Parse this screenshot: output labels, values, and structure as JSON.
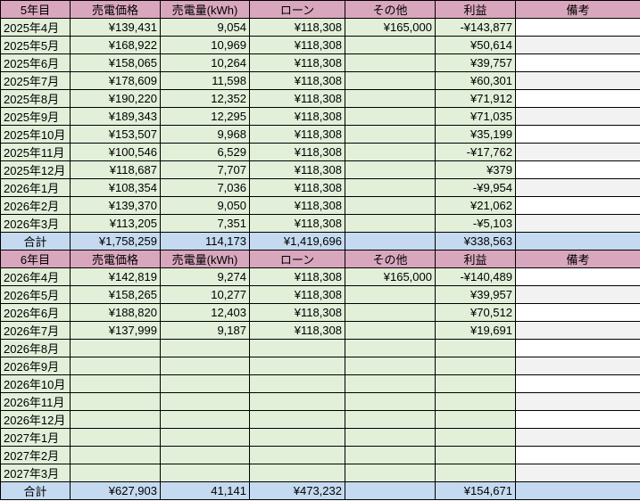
{
  "sections": [
    {
      "header": [
        "5年目",
        "売電価格",
        "売電量(kWh)",
        "ローン",
        "その他",
        "利益",
        "備考"
      ],
      "rows": [
        {
          "month": "2025年4月",
          "price": "¥139,431",
          "kwh": "9,054",
          "loan": "¥118,308",
          "other": "¥165,000",
          "profit": "-¥143,877",
          "note": ""
        },
        {
          "month": "2025年5月",
          "price": "¥168,922",
          "kwh": "10,969",
          "loan": "¥118,308",
          "other": "",
          "profit": "¥50,614",
          "note": ""
        },
        {
          "month": "2025年6月",
          "price": "¥158,065",
          "kwh": "10,264",
          "loan": "¥118,308",
          "other": "",
          "profit": "¥39,757",
          "note": ""
        },
        {
          "month": "2025年7月",
          "price": "¥178,609",
          "kwh": "11,598",
          "loan": "¥118,308",
          "other": "",
          "profit": "¥60,301",
          "note": ""
        },
        {
          "month": "2025年8月",
          "price": "¥190,220",
          "kwh": "12,352",
          "loan": "¥118,308",
          "other": "",
          "profit": "¥71,912",
          "note": ""
        },
        {
          "month": "2025年9月",
          "price": "¥189,343",
          "kwh": "12,295",
          "loan": "¥118,308",
          "other": "",
          "profit": "¥71,035",
          "note": ""
        },
        {
          "month": "2025年10月",
          "price": "¥153,507",
          "kwh": "9,968",
          "loan": "¥118,308",
          "other": "",
          "profit": "¥35,199",
          "note": ""
        },
        {
          "month": "2025年11月",
          "price": "¥100,546",
          "kwh": "6,529",
          "loan": "¥118,308",
          "other": "",
          "profit": "-¥17,762",
          "note": ""
        },
        {
          "month": "2025年12月",
          "price": "¥118,687",
          "kwh": "7,707",
          "loan": "¥118,308",
          "other": "",
          "profit": "¥379",
          "note": ""
        },
        {
          "month": "2026年1月",
          "price": "¥108,354",
          "kwh": "7,036",
          "loan": "¥118,308",
          "other": "",
          "profit": "-¥9,954",
          "note": ""
        },
        {
          "month": "2026年2月",
          "price": "¥139,370",
          "kwh": "9,050",
          "loan": "¥118,308",
          "other": "",
          "profit": "¥21,062",
          "note": ""
        },
        {
          "month": "2026年3月",
          "price": "¥113,205",
          "kwh": "7,351",
          "loan": "¥118,308",
          "other": "",
          "profit": "-¥5,103",
          "note": ""
        }
      ],
      "total": {
        "label": "合計",
        "price": "¥1,758,259",
        "kwh": "114,173",
        "loan": "¥1,419,696",
        "other": "",
        "profit": "¥338,563",
        "note": ""
      }
    },
    {
      "header": [
        "6年目",
        "売電価格",
        "売電量(kWh)",
        "ローン",
        "その他",
        "利益",
        "備考"
      ],
      "rows": [
        {
          "month": "2026年4月",
          "price": "¥142,819",
          "kwh": "9,274",
          "loan": "¥118,308",
          "other": "¥165,000",
          "profit": "-¥140,489",
          "note": ""
        },
        {
          "month": "2026年5月",
          "price": "¥158,265",
          "kwh": "10,277",
          "loan": "¥118,308",
          "other": "",
          "profit": "¥39,957",
          "note": ""
        },
        {
          "month": "2026年6月",
          "price": "¥188,820",
          "kwh": "12,403",
          "loan": "¥118,308",
          "other": "",
          "profit": "¥70,512",
          "note": ""
        },
        {
          "month": "2026年7月",
          "price": "¥137,999",
          "kwh": "9,187",
          "loan": "¥118,308",
          "other": "",
          "profit": "¥19,691",
          "note": ""
        },
        {
          "month": "2026年8月",
          "price": "",
          "kwh": "",
          "loan": "",
          "other": "",
          "profit": "",
          "note": ""
        },
        {
          "month": "2026年9月",
          "price": "",
          "kwh": "",
          "loan": "",
          "other": "",
          "profit": "",
          "note": ""
        },
        {
          "month": "2026年10月",
          "price": "",
          "kwh": "",
          "loan": "",
          "other": "",
          "profit": "",
          "note": ""
        },
        {
          "month": "2026年11月",
          "price": "",
          "kwh": "",
          "loan": "",
          "other": "",
          "profit": "",
          "note": ""
        },
        {
          "month": "2026年12月",
          "price": "",
          "kwh": "",
          "loan": "",
          "other": "",
          "profit": "",
          "note": ""
        },
        {
          "month": "2027年1月",
          "price": "",
          "kwh": "",
          "loan": "",
          "other": "",
          "profit": "",
          "note": ""
        },
        {
          "month": "2027年2月",
          "price": "",
          "kwh": "",
          "loan": "",
          "other": "",
          "profit": "",
          "note": ""
        },
        {
          "month": "2027年3月",
          "price": "",
          "kwh": "",
          "loan": "",
          "other": "",
          "profit": "",
          "note": ""
        }
      ],
      "total": {
        "label": "合計",
        "price": "¥627,903",
        "kwh": "41,141",
        "loan": "¥473,232",
        "other": "",
        "profit": "¥154,671",
        "note": ""
      }
    }
  ]
}
